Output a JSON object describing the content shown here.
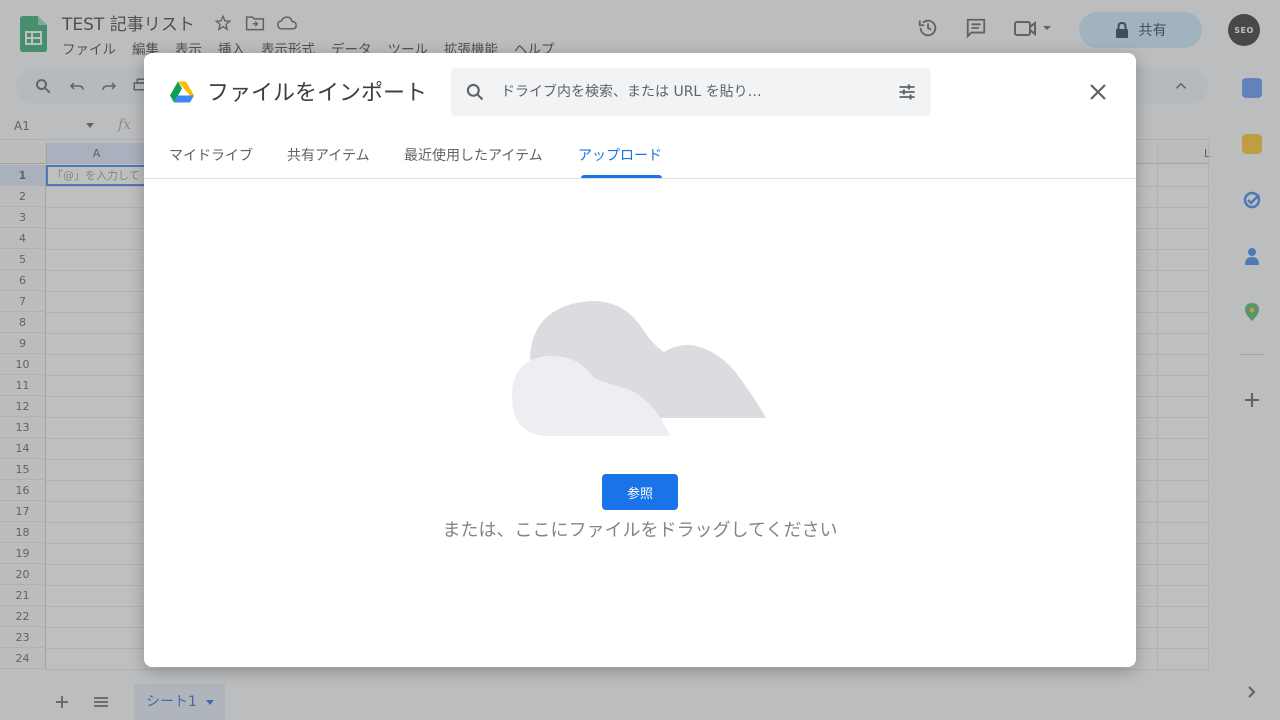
{
  "sheets": {
    "doc_title": "TEST 記事リスト",
    "menu": [
      "ファイル",
      "編集",
      "表示",
      "挿入",
      "表示形式",
      "データ",
      "ツール",
      "拡張機能",
      "ヘルプ"
    ],
    "share_label": "共有",
    "avatar_text": "SEO",
    "name_box": "A1",
    "fx_label": "fx",
    "column_a": "A",
    "column_l": "L",
    "cell_a1": "「@」を入力して",
    "rows": [
      "1",
      "2",
      "3",
      "4",
      "5",
      "6",
      "7",
      "8",
      "9",
      "10",
      "11",
      "12",
      "13",
      "14",
      "15",
      "16",
      "17",
      "18",
      "19",
      "20",
      "21",
      "22",
      "23",
      "24"
    ],
    "sheet_tab": "シート1"
  },
  "dialog": {
    "title": "ファイルをインポート",
    "search_placeholder": "ドライブ内を検索、または URL を貼り…",
    "tabs": [
      "マイドライブ",
      "共有アイテム",
      "最近使用したアイテム",
      "アップロード"
    ],
    "active_tab": "アップロード",
    "browse_label": "参照",
    "drag_hint": "または、ここにファイルをドラッグしてください"
  },
  "colors": {
    "accent": "#1a73e8",
    "overlay": "rgba(128,128,128,0.5)",
    "sheets_green": "#0f9d58",
    "share_bg": "#c2e7ff"
  }
}
